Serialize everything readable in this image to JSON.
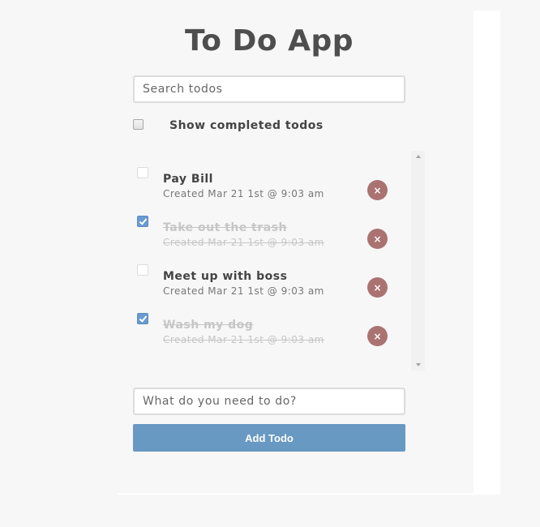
{
  "app": {
    "title": "To Do App"
  },
  "search": {
    "placeholder": "Search todos",
    "value": ""
  },
  "filter": {
    "show_completed_label": "Show completed todos",
    "show_completed_checked": false
  },
  "todos": [
    {
      "title": "Pay Bill",
      "created": "Created Mar 21 1st @ 9:03 am",
      "completed": false,
      "delete_icon": "close-icon"
    },
    {
      "title": "Take out the trash",
      "created": "Created Mar 21 1st @ 9:03 am",
      "completed": true,
      "delete_icon": "close-icon"
    },
    {
      "title": "Meet up with boss",
      "created": "Created Mar 21 1st @ 9:03 am",
      "completed": false,
      "delete_icon": "close-icon"
    },
    {
      "title": "Wash my dog",
      "created": "Created Mar 21 1st @ 9:03 am",
      "completed": true,
      "delete_icon": "close-icon"
    }
  ],
  "new_todo": {
    "placeholder": "What do you need to do?",
    "value": "",
    "add_label": "Add Todo"
  },
  "colors": {
    "accent": "#6899c2",
    "delete": "#ab7272",
    "checked": "#6a9ad0",
    "completed_text": "#c6c6c6"
  },
  "icons": {
    "delete": "×",
    "scroll_up": "triangle-up-icon",
    "scroll_down": "triangle-down-icon"
  }
}
